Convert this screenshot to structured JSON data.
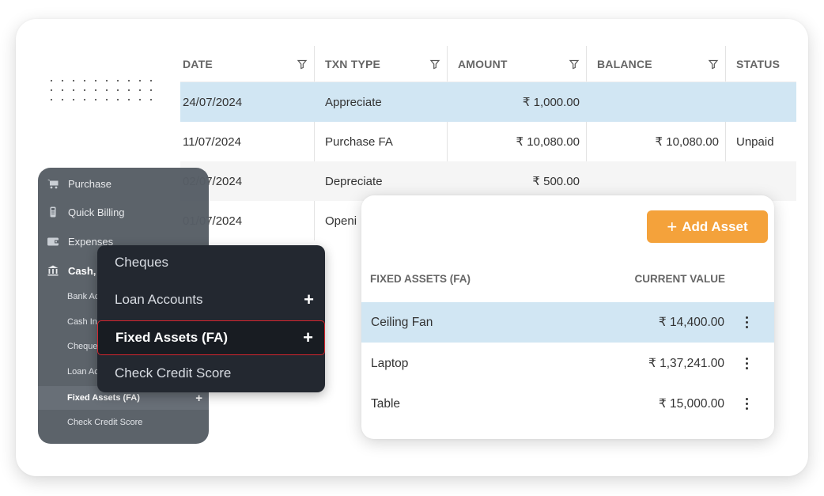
{
  "transactions": {
    "columns": [
      {
        "label": "DATE",
        "filter": true
      },
      {
        "label": "TXN TYPE",
        "filter": true
      },
      {
        "label": "AMOUNT",
        "filter": true
      },
      {
        "label": "BALANCE",
        "filter": true
      },
      {
        "label": "STATUS",
        "filter": false
      }
    ],
    "rows": [
      {
        "date": "24/07/2024",
        "type": "Appreciate",
        "amount": "₹ 1,000.00",
        "balance": "",
        "status": "",
        "selected": true
      },
      {
        "date": "11/07/2024",
        "type": "Purchase FA",
        "amount": "₹ 10,080.00",
        "balance": "₹ 10,080.00",
        "status": "Unpaid"
      },
      {
        "date": "02/07/2024",
        "type": "Depreciate",
        "amount": "₹ 500.00",
        "balance": "",
        "status": ""
      },
      {
        "date": "01/07/2024",
        "type": "Openi",
        "amount": "",
        "balance": "",
        "status": ""
      }
    ],
    "status_color": "#4a86e8",
    "selected_row_color": "#d1e6f3"
  },
  "sidebar": {
    "items": [
      {
        "label": "Purchase",
        "icon": "cart-icon"
      },
      {
        "label": "Quick Billing",
        "icon": "pos-device-icon"
      },
      {
        "label": "Expenses",
        "icon": "wallet-icon"
      },
      {
        "label": "Cash, B",
        "icon": "bank-icon"
      }
    ],
    "sub_items": [
      {
        "label": "Bank Ac"
      },
      {
        "label": "Cash In"
      },
      {
        "label": "Cheque"
      },
      {
        "label": "Loan Ac"
      }
    ],
    "active_sub": {
      "label": "Fixed Assets (FA)",
      "action": "+"
    },
    "last_sub": {
      "label": "Check Credit Score"
    }
  },
  "menu": {
    "items": [
      {
        "label": "Cheques",
        "plus": ""
      },
      {
        "label": "Loan Accounts",
        "plus": "+"
      },
      {
        "label": "Fixed Assets (FA)",
        "plus": "+",
        "active": true
      },
      {
        "label": "Check Credit Score",
        "plus": ""
      }
    ],
    "active_border_color": "#d3252e"
  },
  "fixed_assets": {
    "add_button": {
      "icon": "+",
      "label": "Add Asset"
    },
    "button_color": "#f4a23b",
    "headers": {
      "name": "FIXED ASSETS (FA)",
      "value": "CURRENT VALUE"
    },
    "rows": [
      {
        "name": "Ceiling Fan",
        "value": "₹ 14,400.00",
        "selected": true
      },
      {
        "name": "Laptop",
        "value": "₹ 1,37,241.00"
      },
      {
        "name": "Table",
        "value": "₹ 15,000.00"
      }
    ]
  }
}
